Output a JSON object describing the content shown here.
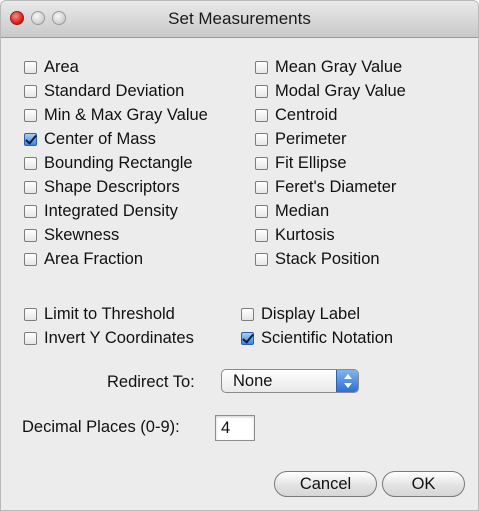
{
  "window": {
    "title": "Set Measurements"
  },
  "measurements": [
    {
      "label": "Area",
      "checked": false
    },
    {
      "label": "Standard Deviation",
      "checked": false
    },
    {
      "label": "Min & Max Gray Value",
      "checked": false
    },
    {
      "label": "Center of Mass",
      "checked": true
    },
    {
      "label": "Bounding Rectangle",
      "checked": false
    },
    {
      "label": "Shape Descriptors",
      "checked": false
    },
    {
      "label": "Integrated Density",
      "checked": false
    },
    {
      "label": "Skewness",
      "checked": false
    },
    {
      "label": "Area Fraction",
      "checked": false
    },
    {
      "label": "Mean Gray Value",
      "checked": false
    },
    {
      "label": "Modal Gray Value",
      "checked": false
    },
    {
      "label": "Centroid",
      "checked": false
    },
    {
      "label": "Perimeter",
      "checked": false
    },
    {
      "label": "Fit Ellipse",
      "checked": false
    },
    {
      "label": "Feret's Diameter",
      "checked": false
    },
    {
      "label": "Median",
      "checked": false
    },
    {
      "label": "Kurtosis",
      "checked": false
    },
    {
      "label": "Stack Position",
      "checked": false
    }
  ],
  "options": [
    {
      "label": "Limit to Threshold",
      "checked": false
    },
    {
      "label": "Invert Y Coordinates",
      "checked": false
    },
    {
      "label": "Display Label",
      "checked": false
    },
    {
      "label": "Scientific Notation",
      "checked": true
    }
  ],
  "redirect": {
    "label": "Redirect To:",
    "value": "None"
  },
  "decimal": {
    "label": "Decimal Places (0-9):",
    "value": "4"
  },
  "buttons": {
    "cancel": "Cancel",
    "ok": "OK"
  }
}
